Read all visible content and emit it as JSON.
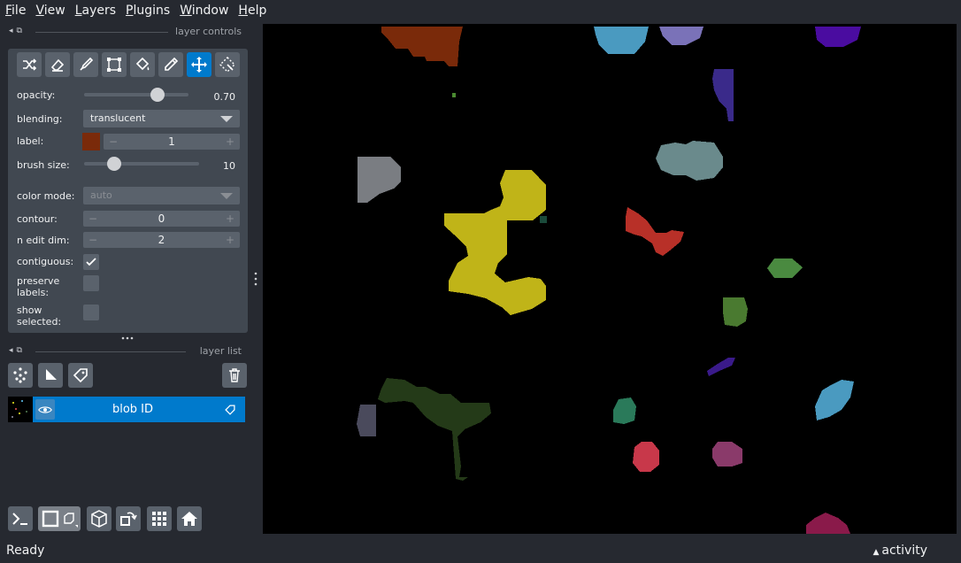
{
  "menu": [
    "File",
    "View",
    "Layers",
    "Plugins",
    "Window",
    "Help"
  ],
  "layer_controls": {
    "title": "layer controls",
    "opacity_label": "opacity:",
    "opacity_value": "0.70",
    "opacity_fraction": 0.7,
    "blending_label": "blending:",
    "blending_value": "translucent",
    "label_label": "label:",
    "label_value": "1",
    "label_color": "#7a2a0a",
    "brush_size_label": "brush size:",
    "brush_size_value": "10",
    "color_mode_label": "color mode:",
    "color_mode_value": "auto",
    "contour_label": "contour:",
    "contour_value": "0",
    "n_edit_dim_label": "n edit dim:",
    "n_edit_dim_value": "2",
    "contiguous_label": "contiguous:",
    "contiguous_checked": true,
    "preserve_labels_label": "preserve labels:",
    "show_selected_label": "show selected:",
    "tools": [
      "shuffle-icon",
      "eraser-icon",
      "paintbrush-icon",
      "polygon-icon",
      "fill-bucket-icon",
      "color-picker-icon",
      "pan-zoom-icon",
      "transform-icon"
    ],
    "active_tool": "pan-zoom-icon"
  },
  "layer_list": {
    "title": "layer list",
    "layers": [
      {
        "name": "blob ID",
        "visible": true
      }
    ]
  },
  "status": {
    "text": "Ready",
    "activity": "activity"
  },
  "colors": {
    "accent": "#007acc",
    "panel": "#414851",
    "background": "#262930"
  }
}
